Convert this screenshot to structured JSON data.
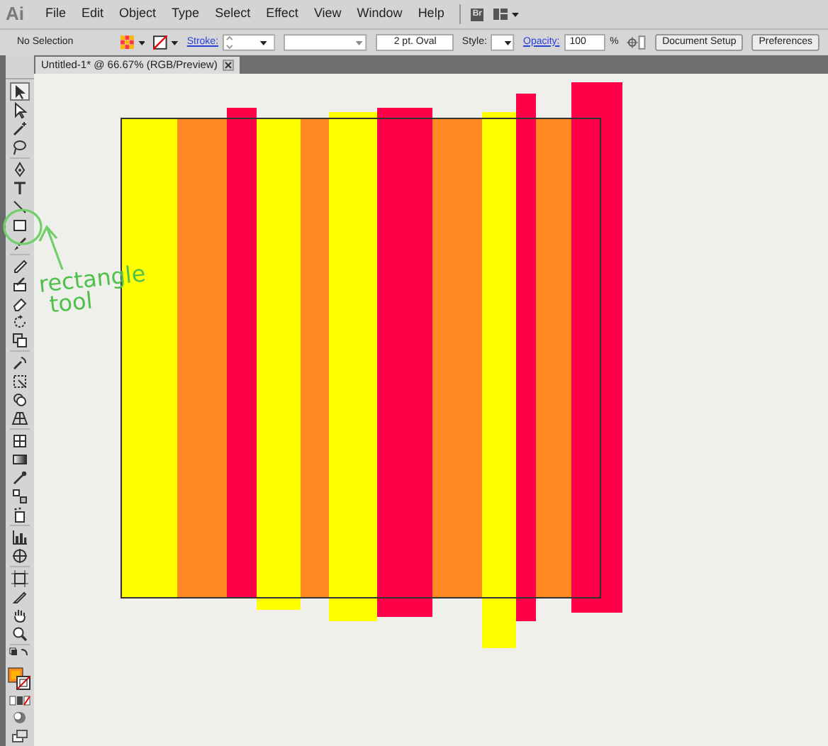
{
  "app": {
    "logo": "Ai"
  },
  "menu": [
    "File",
    "Edit",
    "Object",
    "Type",
    "Select",
    "Effect",
    "View",
    "Window",
    "Help"
  ],
  "bridge_button": "Br",
  "control_bar": {
    "selection": "No Selection",
    "stroke_label": "Stroke:",
    "brush": "2 pt. Oval",
    "style_label": "Style:",
    "opacity_label": "Opacity:",
    "opacity": "100",
    "percent": "%",
    "buttons": [
      "Document Setup",
      "Preferences"
    ]
  },
  "tab": {
    "title": "Untitled-1* @ 66.67% (RGB/Preview)"
  },
  "toolbox": {
    "tools": [
      {
        "kind": "select",
        "selected": true
      },
      {
        "kind": "direct",
        "selected": false
      },
      {
        "kind": "wand",
        "selected": false
      },
      {
        "kind": "lasso",
        "selected": false
      },
      {
        "kind": "pen",
        "selected": false
      },
      {
        "kind": "type",
        "selected": false
      },
      {
        "kind": "line",
        "selected": false
      },
      {
        "kind": "rect",
        "selected": false
      },
      {
        "kind": "brush",
        "selected": false
      },
      {
        "kind": "pencil",
        "selected": false
      },
      {
        "kind": "blob",
        "selected": false
      },
      {
        "kind": "eraser",
        "selected": false
      },
      {
        "kind": "rotate",
        "selected": false
      },
      {
        "kind": "scale",
        "selected": false
      },
      {
        "kind": "warp",
        "selected": false
      },
      {
        "kind": "free",
        "selected": false
      },
      {
        "kind": "shape",
        "selected": false
      },
      {
        "kind": "persp",
        "selected": false
      },
      {
        "kind": "mesh",
        "selected": false
      },
      {
        "kind": "gradient",
        "selected": false
      },
      {
        "kind": "eyedropper",
        "selected": false
      },
      {
        "kind": "blend",
        "selected": false
      },
      {
        "kind": "spray",
        "selected": false
      },
      {
        "kind": "graph",
        "selected": false
      },
      {
        "kind": "slice",
        "selected": false
      },
      {
        "kind": "artboard",
        "selected": false
      },
      {
        "kind": "knife",
        "selected": false
      },
      {
        "kind": "hand",
        "selected": false
      },
      {
        "kind": "zoom",
        "selected": false
      }
    ]
  },
  "annotation": {
    "lines": [
      "rectangle",
      "tool"
    ]
  }
}
